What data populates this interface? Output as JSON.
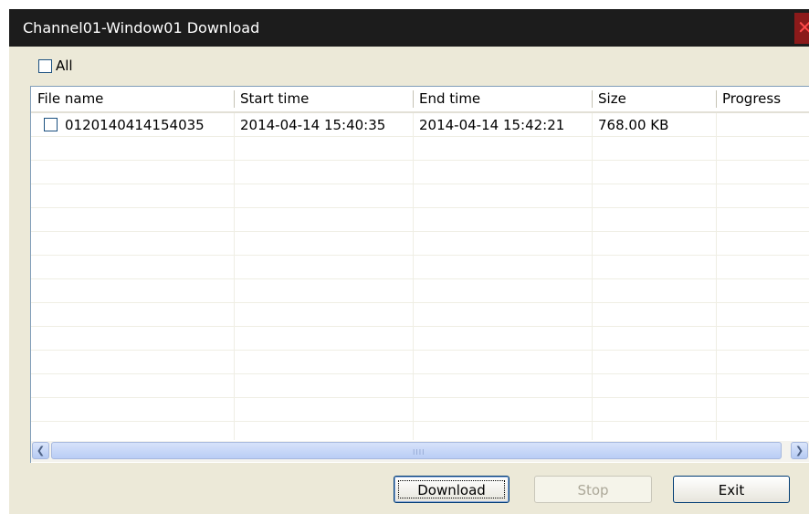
{
  "window": {
    "title": "Channel01-Window01 Download"
  },
  "select_all": {
    "label": "All",
    "checked": false
  },
  "table": {
    "columns": [
      "File name",
      "Start time",
      "End time",
      "Size",
      "Progress"
    ],
    "rows": [
      {
        "checked": false,
        "file_name": "0120140414154035",
        "start_time": "2014-04-14 15:40:35",
        "end_time": "2014-04-14 15:42:21",
        "size": "768.00 KB",
        "progress": ""
      }
    ]
  },
  "scrollbar": {
    "grip": "IIII"
  },
  "buttons": {
    "download": "Download",
    "stop": "Stop",
    "exit": "Exit"
  },
  "icons": {
    "close": "close-icon",
    "scroll_left": "scroll-left-icon",
    "scroll_right": "scroll-right-icon"
  }
}
